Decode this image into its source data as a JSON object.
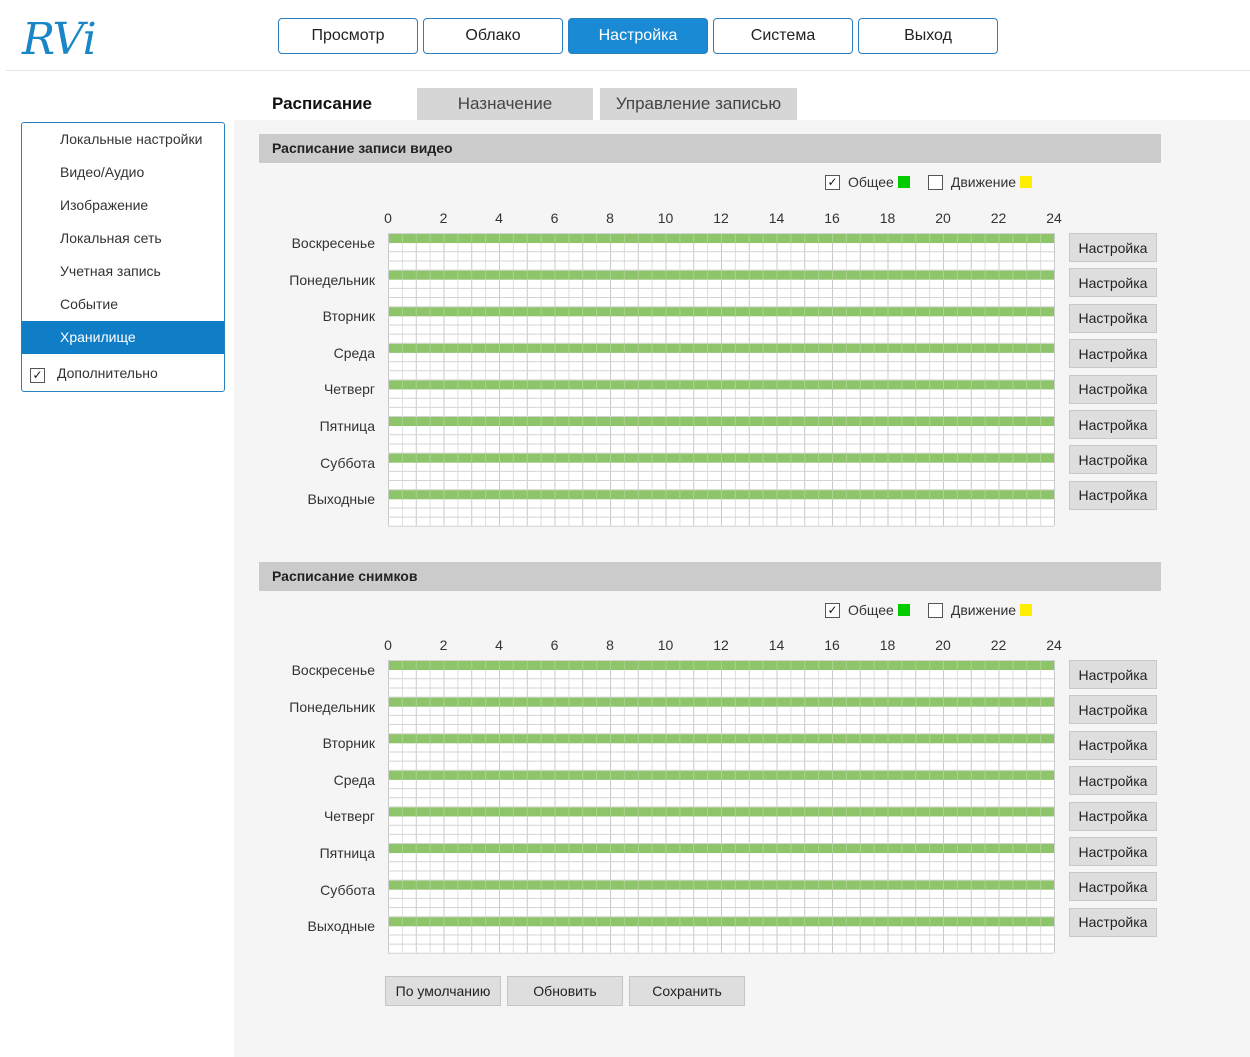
{
  "logo": "RVi",
  "topnav": [
    {
      "label": "Просмотр",
      "active": false
    },
    {
      "label": "Облако",
      "active": false
    },
    {
      "label": "Настройка",
      "active": true
    },
    {
      "label": "Система",
      "active": false
    },
    {
      "label": "Выход",
      "active": false
    }
  ],
  "sidebar": {
    "items": [
      {
        "label": "Локальные настройки",
        "active": false
      },
      {
        "label": "Видео/Аудио",
        "active": false
      },
      {
        "label": "Изображение",
        "active": false
      },
      {
        "label": "Локальная сеть",
        "active": false
      },
      {
        "label": "Учетная запись",
        "active": false
      },
      {
        "label": "Событие",
        "active": false
      },
      {
        "label": "Хранилище",
        "active": true
      }
    ],
    "extra": {
      "label": "Дополнительно",
      "checked": true
    }
  },
  "tabs": [
    {
      "label": "Расписание",
      "active": true
    },
    {
      "label": "Назначение",
      "active": false
    },
    {
      "label": "Управление записью",
      "active": false
    }
  ],
  "colors": {
    "general": "#00cc00",
    "motion": "#ffee00",
    "bar": "#8ec56b",
    "accent": "#1a8ad4"
  },
  "hours": [
    "0",
    "2",
    "4",
    "6",
    "8",
    "10",
    "12",
    "14",
    "16",
    "18",
    "20",
    "22",
    "24"
  ],
  "days": [
    "Воскресенье",
    "Понедельник",
    "Вторник",
    "Среда",
    "Четверг",
    "Пятница",
    "Суббота",
    "Выходные"
  ],
  "sections": [
    {
      "title": "Расписание записи видео",
      "legend": {
        "general_label": "Общее",
        "general_checked": true,
        "motion_label": "Движение",
        "motion_checked": false
      },
      "config_label": "Настройка",
      "schedule": [
        {
          "day": "Воскресенье",
          "type": "general",
          "from": 0,
          "to": 24
        },
        {
          "day": "Понедельник",
          "type": "general",
          "from": 0,
          "to": 24
        },
        {
          "day": "Вторник",
          "type": "general",
          "from": 0,
          "to": 24
        },
        {
          "day": "Среда",
          "type": "general",
          "from": 0,
          "to": 24
        },
        {
          "day": "Четверг",
          "type": "general",
          "from": 0,
          "to": 24
        },
        {
          "day": "Пятница",
          "type": "general",
          "from": 0,
          "to": 24
        },
        {
          "day": "Суббота",
          "type": "general",
          "from": 0,
          "to": 24
        },
        {
          "day": "Выходные",
          "type": "general",
          "from": 0,
          "to": 24
        }
      ]
    },
    {
      "title": "Расписание снимков",
      "legend": {
        "general_label": "Общее",
        "general_checked": true,
        "motion_label": "Движение",
        "motion_checked": false
      },
      "config_label": "Настройка",
      "schedule": [
        {
          "day": "Воскресенье",
          "type": "general",
          "from": 0,
          "to": 24
        },
        {
          "day": "Понедельник",
          "type": "general",
          "from": 0,
          "to": 24
        },
        {
          "day": "Вторник",
          "type": "general",
          "from": 0,
          "to": 24
        },
        {
          "day": "Среда",
          "type": "general",
          "from": 0,
          "to": 24
        },
        {
          "day": "Четверг",
          "type": "general",
          "from": 0,
          "to": 24
        },
        {
          "day": "Пятница",
          "type": "general",
          "from": 0,
          "to": 24
        },
        {
          "day": "Суббота",
          "type": "general",
          "from": 0,
          "to": 24
        },
        {
          "day": "Выходные",
          "type": "general",
          "from": 0,
          "to": 24
        }
      ]
    }
  ],
  "buttons": {
    "default": "По умолчанию",
    "refresh": "Обновить",
    "save": "Сохранить"
  }
}
